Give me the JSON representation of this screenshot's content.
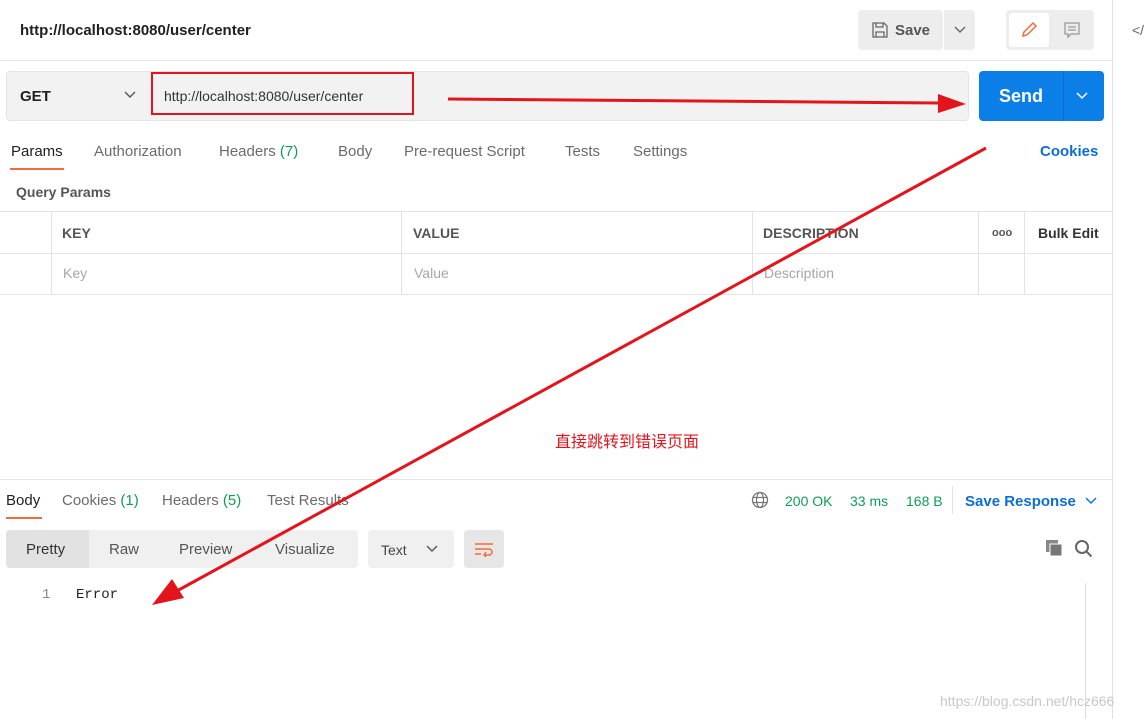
{
  "header": {
    "title": "http://localhost:8080/user/center",
    "save_label": "Save",
    "side_icon": "</"
  },
  "request": {
    "method": "GET",
    "url": "http://localhost:8080/user/center",
    "send_label": "Send"
  },
  "tabs": [
    {
      "label": "Params"
    },
    {
      "label": "Authorization"
    },
    {
      "label": "Headers"
    },
    {
      "label": "Body"
    },
    {
      "label": "Pre-request Script"
    },
    {
      "label": "Tests"
    },
    {
      "label": "Settings"
    }
  ],
  "headers_count": "(7)",
  "cookies_label": "Cookies",
  "query_params": {
    "title": "Query Params",
    "columns": [
      "KEY",
      "VALUE",
      "DESCRIPTION"
    ],
    "bulk_edit": "Bulk Edit",
    "more": "ooo",
    "placeholders": [
      "Key",
      "Value",
      "Description"
    ]
  },
  "annotation": {
    "text": "直接跳转到错误页面",
    "color": "#e3141c"
  },
  "response": {
    "tabs": [
      {
        "label": "Body"
      },
      {
        "label": "Cookies",
        "count": "(1)"
      },
      {
        "label": "Headers",
        "count": "(5)"
      },
      {
        "label": "Test Results"
      }
    ],
    "status": "200 OK",
    "time": "33 ms",
    "size": "168 B",
    "save_response": "Save Response",
    "views": [
      "Pretty",
      "Raw",
      "Preview",
      "Visualize"
    ],
    "format": "Text",
    "lines": [
      {
        "num": "1",
        "text": "Error"
      }
    ]
  },
  "watermark": "https://blog.csdn.net/hcz666",
  "colors": {
    "accent": "#f26b3a",
    "send": "#0b7ee8",
    "link": "#0b6fd4",
    "ok": "#0f9d58"
  }
}
